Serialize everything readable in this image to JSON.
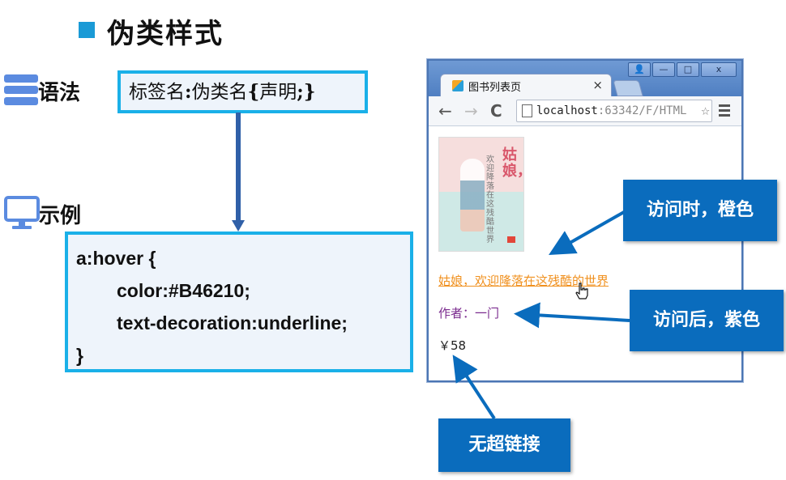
{
  "heading": {
    "title": "伪类样式"
  },
  "labels": {
    "syntax": "语法",
    "example": "示例"
  },
  "syntax_box": {
    "text_prefix": "标签名",
    "colon": ":",
    "pseudo": "伪类名",
    "brace_open": "{",
    "decl": "声明",
    "semicolon": ";",
    "brace_close": "}"
  },
  "code": {
    "line1": "a:hover {",
    "line2": "color:#B46210;",
    "line3": "text-decoration:underline;",
    "line4": "}"
  },
  "browser": {
    "tab_title": "图书列表页",
    "tab_close": "×",
    "url_host": "localhost",
    "url_rest": ":63342/F/HTML",
    "window_buttons": [
      "user-icon",
      "minimize-icon",
      "maximize-icon",
      "close-icon"
    ],
    "window_button_glyphs": [
      "👤",
      "—",
      "□",
      "x"
    ],
    "nav_back": "←",
    "nav_forward": "→",
    "nav_reload": "C",
    "star": "☆",
    "book_cover_title": "姑娘，",
    "book_cover_sub": "欢迎降落在这残酷世界",
    "book_link": "姑娘，欢迎隆落在这残酷的世界",
    "book_author": "作者：一门",
    "book_price": "￥58"
  },
  "callouts": {
    "visited_hover": "访问时，橙色",
    "visited_after": "访问后，紫色",
    "no_link": "无超链接"
  },
  "colors": {
    "accent": "#1a9ad6",
    "box_border": "#1ab0e8",
    "callout_bg": "#0a6cbd",
    "link_orange": "#f0901e",
    "visited_purple": "#7a2a8e",
    "connector": "#3060a8"
  }
}
